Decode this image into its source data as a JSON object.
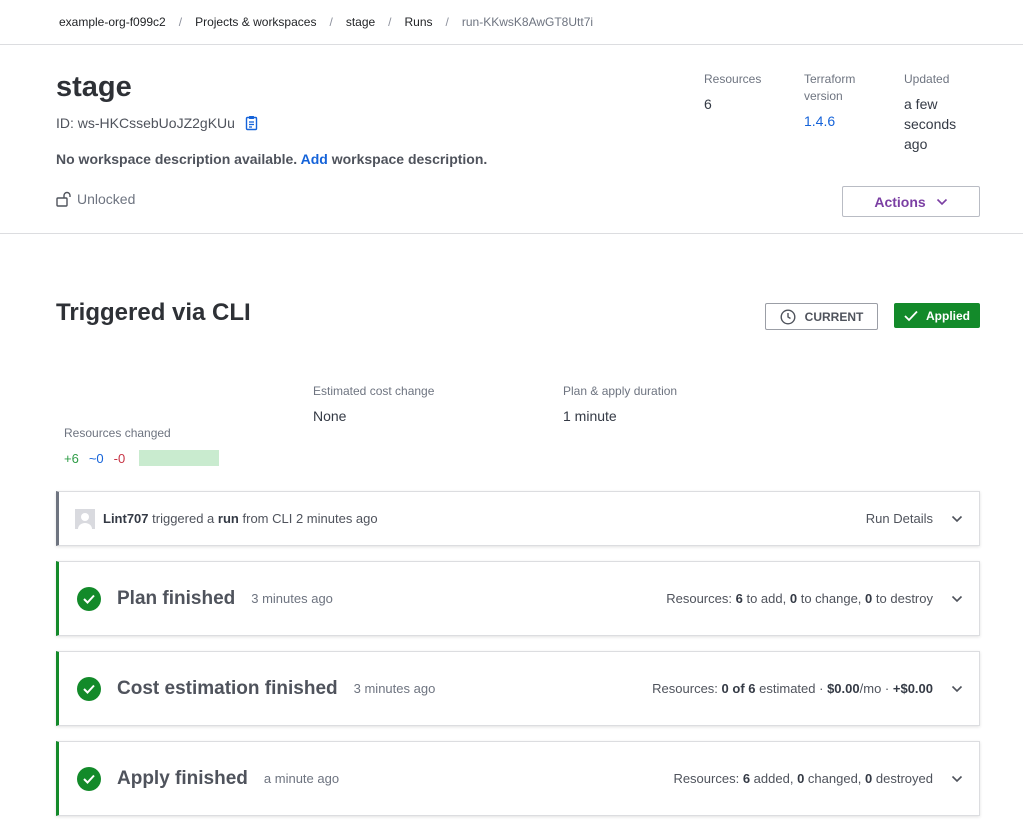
{
  "breadcrumb": {
    "items": [
      "example-org-f099c2",
      "Projects & workspaces",
      "stage",
      "Runs",
      "run-KKwsK8AwGT8Utt7i"
    ],
    "separator": "/"
  },
  "workspace": {
    "name": "stage",
    "id_text": "ID: ws-HKCssebUoJZ2gKUu",
    "desc_prefix": "No workspace description available.",
    "desc_link": "Add",
    "desc_suffix": "workspace description.",
    "lock_status": "Unlocked",
    "meta": {
      "resources_label": "Resources",
      "resources_value": "6",
      "tf_label_line1": "Terraform",
      "tf_label_line2": "version",
      "tf_value": "1.4.6",
      "updated_label": "Updated",
      "updated_line1": "a few",
      "updated_line2": "seconds",
      "updated_line3": "ago"
    },
    "actions_label": "Actions"
  },
  "run": {
    "title": "Triggered via CLI",
    "badge_current": "CURRENT",
    "badge_applied": "Applied",
    "resources_changed_label": "Resources changed",
    "added": "+6",
    "changed": "~0",
    "destroyed": "-0",
    "cost_label": "Estimated cost change",
    "cost_value": "None",
    "duration_label": "Plan & apply duration",
    "duration_value": "1 minute",
    "trigger": {
      "user": "Lint707",
      "text1": "triggered a",
      "run_word": "run",
      "text2": "from CLI 2 minutes ago",
      "details": "Run Details"
    },
    "stages": [
      {
        "title": "Plan finished",
        "time": "3 minutes ago",
        "summary": {
          "prefix": "Resources:",
          "n1": "6",
          "t1": "to add,",
          "n2": "0",
          "t2": "to change,",
          "n3": "0",
          "t3": "to destroy"
        }
      },
      {
        "title": "Cost estimation finished",
        "time": "3 minutes ago",
        "summary": {
          "prefix": "Resources:",
          "n1": "0 of 6",
          "t1": "estimated ·",
          "n2": "$0.00",
          "t2": "/mo ·",
          "n3": "+$0.00",
          "t3": ""
        }
      },
      {
        "title": "Apply finished",
        "time": "a minute ago",
        "summary": {
          "prefix": "Resources:",
          "n1": "6",
          "t1": "added,",
          "n2": "0",
          "t2": "changed,",
          "n3": "0",
          "t3": "destroyed"
        }
      }
    ]
  },
  "colors": {
    "success": "#138a2a",
    "link": "#1563d9",
    "actions": "#7b3fa3",
    "destroy": "#c73445"
  }
}
